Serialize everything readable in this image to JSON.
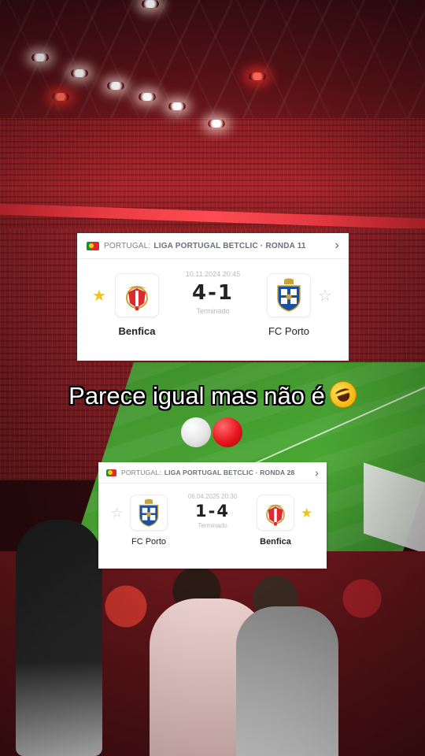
{
  "caption": {
    "text": "Parece igual mas não é",
    "emoji": "rolling-on-floor-laughing-emoji",
    "circles": [
      "white-circle-emoji",
      "red-circle-emoji"
    ]
  },
  "colors": {
    "benfica_red": "#e0282f",
    "porto_blue": "#1d4fa0",
    "favorite_star": "#f3c318",
    "muted_text": "#b6b9be"
  },
  "matches": [
    {
      "country": "PORTUGAL:",
      "league": "LIGA PORTUGAL BETCLIC · RONDA 11",
      "datetime": "10.11.2024 20:45",
      "score": "4-1",
      "status": "Terminado",
      "home": {
        "name": "Benfica",
        "crest": "benfica-crest",
        "favorite": true,
        "winner": true
      },
      "away": {
        "name": "FC Porto",
        "crest": "porto-crest",
        "favorite": false,
        "winner": false
      }
    },
    {
      "country": "PORTUGAL:",
      "league": "LIGA PORTUGAL BETCLIC · RONDA 28",
      "datetime": "06.04.2025 20:30",
      "score": "1-4",
      "status": "Terminado",
      "home": {
        "name": "FC Porto",
        "crest": "porto-crest",
        "favorite": false,
        "winner": false
      },
      "away": {
        "name": "Benfica",
        "crest": "benfica-crest",
        "favorite": true,
        "winner": true
      }
    }
  ]
}
